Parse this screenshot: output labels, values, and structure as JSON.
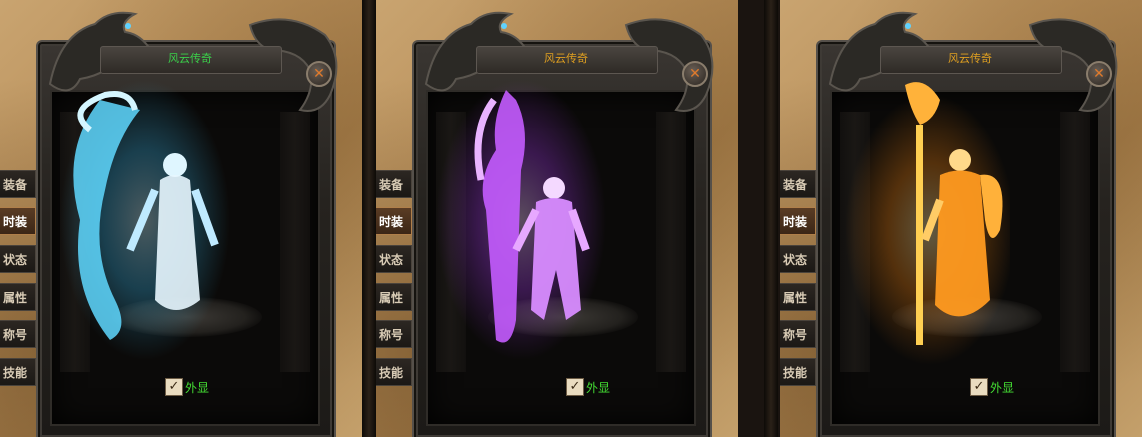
{
  "panels": [
    {
      "title": "风云传奇",
      "close_label": "✕",
      "tabs": [
        "装备",
        "时装",
        "状态",
        "属性",
        "称号",
        "技能"
      ],
      "active_tab": 1,
      "checkbox": {
        "label": "外显",
        "checked": true,
        "mark": "✓"
      },
      "glow": {
        "color": "#3fc7ff",
        "core": "#c9f2ff",
        "variant": "ice"
      }
    },
    {
      "title": "风云传奇",
      "close_label": "✕",
      "tabs": [
        "装备",
        "时装",
        "状态",
        "属性",
        "称号",
        "技能"
      ],
      "active_tab": 1,
      "checkbox": {
        "label": "外显",
        "checked": true,
        "mark": "✓"
      },
      "glow": {
        "color": "#b23dff",
        "core": "#f2c9ff",
        "variant": "arcane"
      }
    },
    {
      "title": "风云传奇",
      "close_label": "✕",
      "tabs": [
        "装备",
        "时装",
        "状态",
        "属性",
        "称号",
        "技能"
      ],
      "active_tab": 1,
      "checkbox": {
        "label": "外显",
        "checked": true,
        "mark": "✓"
      },
      "glow": {
        "color": "#ff8a12",
        "core": "#fff0b0",
        "variant": "flame"
      }
    }
  ],
  "colors": {
    "title_text": "#3ad14a",
    "title_text_alt": "#e0a020",
    "checkbox_label": "#44dd33",
    "close_x": "#e07a2c"
  }
}
